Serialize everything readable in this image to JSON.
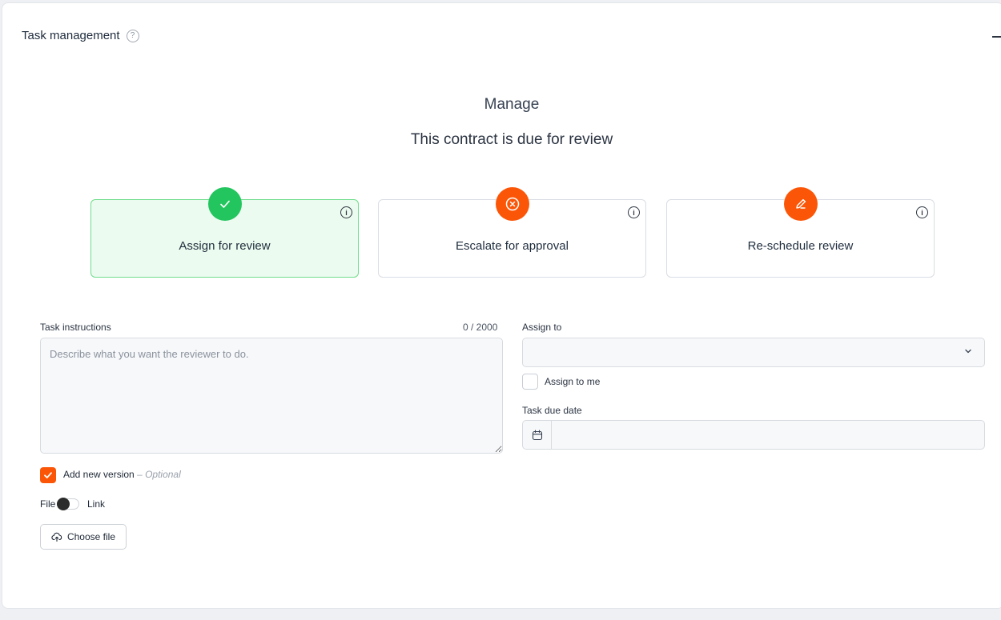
{
  "header": {
    "title": "Task management",
    "help": "?"
  },
  "manage": {
    "title": "Manage",
    "subtitle": "This contract is due for review"
  },
  "options": [
    {
      "label": "Assign for review",
      "icon": "check-icon",
      "color": "#22c55e",
      "active": true
    },
    {
      "label": "Escalate for approval",
      "icon": "x-circle-icon",
      "color": "#fb5607",
      "active": false
    },
    {
      "label": "Re-schedule review",
      "icon": "pencil-icon",
      "color": "#fb5607",
      "active": false
    }
  ],
  "form": {
    "instructions_label": "Task instructions",
    "counter": "0 / 2000",
    "instructions_placeholder": "Describe what you want the reviewer to do.",
    "instructions_value": "",
    "assign_to_label": "Assign to",
    "assign_to_value": "",
    "assign_to_me_label": "Assign to me",
    "due_date_label": "Task due date",
    "due_date_value": "",
    "add_version_label": "Add new version",
    "add_version_optional": "– Optional",
    "file_label": "File",
    "link_label": "Link",
    "choose_file_label": "Choose file"
  },
  "colors": {
    "accent": "#fb5607",
    "success": "#22c55e"
  }
}
